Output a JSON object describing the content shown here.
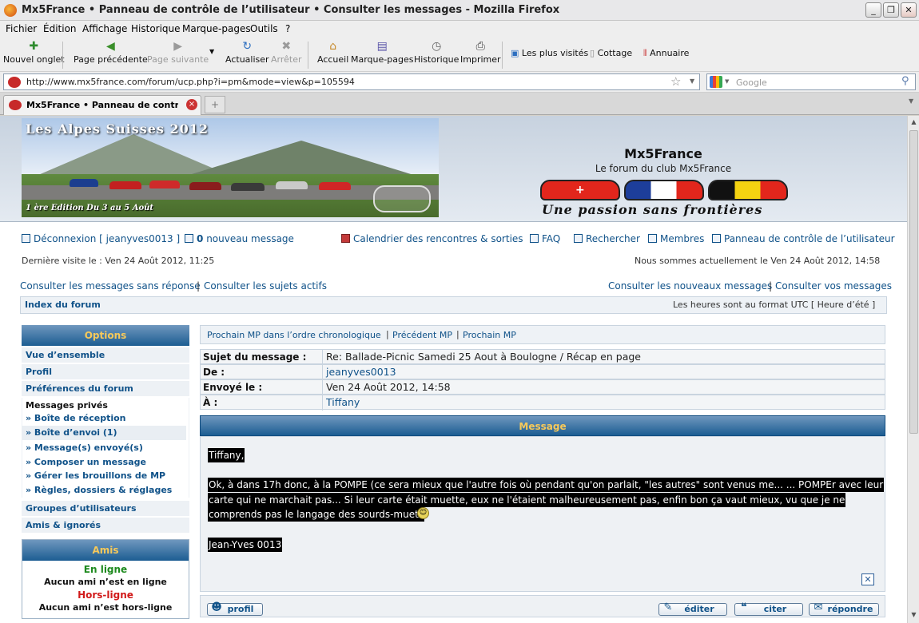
{
  "window": {
    "title": "Mx5France • Panneau de contrôle de l’utilisateur • Consulter les messages - Mozilla Firefox",
    "min": "_",
    "max": "❐",
    "close": "✕"
  },
  "menu": [
    "Fichier",
    "Édition",
    "Affichage",
    "Historique",
    "Marque-pages",
    "Outils",
    "?"
  ],
  "toolbar": {
    "new_tab": "Nouvel onglet",
    "back": "Page précédente",
    "forward": "Page suivante",
    "reload": "Actualiser",
    "stop": "Arrêter",
    "home": "Accueil",
    "bookmarks": "Marque-pages",
    "history": "Historique",
    "print": "Imprimer",
    "bm_most_visited": "Les plus visités",
    "bm_cottage": "Cottage",
    "bm_annuaire": "Annuaire"
  },
  "urlbar": {
    "url": "http://www.mx5france.com/forum/ucp.php?i=pm&mode=view&p=105594",
    "search_placeholder": "Google"
  },
  "tab": {
    "label": "Mx5France • Panneau de contrôle d...",
    "new_tab": "+"
  },
  "banner": {
    "photo_title": "Les Alpes Suisses 2012",
    "photo_subtitle": "1 ère Edition Du 3 au 5 Août",
    "site_name": "Mx5France",
    "site_desc": "Le forum du club Mx5France",
    "slogan": "Une passion sans frontières"
  },
  "nav": {
    "logout": "Déconnexion [ jeanyves0013 ]",
    "new_messages_count": "0",
    "new_messages": "nouveau message",
    "calendar": "Calendrier des rencontres & sorties",
    "faq": "FAQ",
    "search": "Rechercher",
    "members": "Membres",
    "ucp": "Panneau de contrôle de l’utilisateur",
    "last_visit": "Dernière visite le : Ven 24 Août 2012, 11:25",
    "now": "Nous sommes actuellement le Ven 24 Août 2012, 14:58",
    "unanswered": "Consulter les messages sans réponse",
    "active": "Consulter les sujets actifs",
    "new_posts": "Consulter les nouveaux messages",
    "your_posts": "Consulter vos messages",
    "pipe": "|",
    "forum_index": "Index du forum",
    "timezone": "Les heures sont au format UTC [ Heure d’été ]"
  },
  "sidebar": {
    "options_title": "Options",
    "overview": "Vue d’ensemble",
    "profile": "Profil",
    "prefs": "Préférences du forum",
    "pm_title": "Messages privés",
    "pm_items": [
      "» Boîte de réception",
      "» Boîte d’envoi (1)",
      "» Message(s) envoyé(s)",
      "» Composer un message",
      "» Gérer les brouillons de MP",
      "» Règles, dossiers & réglages"
    ],
    "usergroups": "Groupes d’utilisateurs",
    "friends_foes": "Amis & ignorés",
    "friends_title": "Amis",
    "online": "En ligne",
    "online_none": "Aucun ami n’est en ligne",
    "offline": "Hors-ligne",
    "offline_none": "Aucun ami n’est hors-ligne"
  },
  "message": {
    "nav_next_chrono": "Prochain MP dans l’ordre chronologique",
    "nav_prev": "Précédent MP",
    "nav_next": "Prochain MP",
    "subject_label": "Sujet du message :",
    "subject": "Re: Ballade-Picnic Samedi 25 Aout à Boulogne / Récap en page",
    "from_label": "De :",
    "from": "jeanyves0013",
    "sent_label": "Envoyé le :",
    "sent": "Ven 24 Août 2012, 14:58",
    "to_label": "À :",
    "to": "Tiffany",
    "bar_title": "Message",
    "line1": "Tiffany,",
    "line2": "Ok, à dans 17h donc, à la POMPE (ce sera mieux que l'autre fois où pendant qu'on parlait, \"les autres\" sont venus me... ... POMPEr avec leur",
    "line3": "carte qui ne marchait pas... Si leur carte était muette, eux ne l'étaient malheureusement pas, enfin bon ça vaut mieux, vu que je ne",
    "line4": "comprends pas le langage des sourds-muets",
    "signature": "Jean-Yves 0013",
    "btn_profile": "profil",
    "btn_edit": "éditer",
    "btn_quote": "citer",
    "btn_reply": "répondre"
  },
  "colors": {
    "link": "#105289",
    "header_gradient_top": "#6f97be",
    "header_gradient_bottom": "#1c5d92",
    "header_text": "#f7c95a",
    "online": "#1e8a1e",
    "offline": "#d11a1a"
  },
  "icons": [
    "firefox-icon",
    "new-tab-icon",
    "back-arrow-icon",
    "forward-arrow-icon",
    "reload-icon",
    "stop-icon",
    "home-icon",
    "bookmarks-icon",
    "history-clock-icon",
    "printer-icon",
    "star-icon",
    "search-magnifier-icon",
    "smiley-icon",
    "delete-x-icon"
  ]
}
